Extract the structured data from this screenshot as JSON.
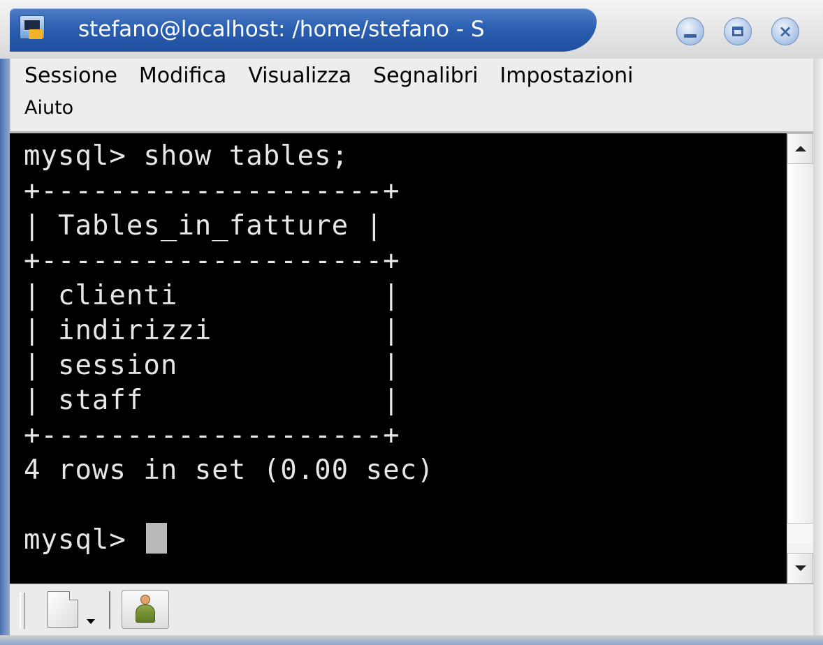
{
  "window": {
    "title": "stefano@localhost: /home/stefano - S"
  },
  "menu": {
    "items": [
      "Sessione",
      "Modifica",
      "Visualizza",
      "Segnalibri",
      "Impostazioni",
      "Aiuto"
    ]
  },
  "terminal": {
    "lines": [
      "mysql> show tables;",
      "+--------------------+",
      "| Tables_in_fatture |",
      "+--------------------+",
      "| clienti            |",
      "| indirizzi          |",
      "| session            |",
      "| staff              |",
      "+--------------------+",
      "4 rows in set (0.00 sec)",
      "",
      "mysql> "
    ]
  },
  "icons": {
    "app": "terminal-app-icon",
    "minimize": "minimize-icon",
    "maximize": "maximize-icon",
    "close": "close-icon",
    "new_session": "new-document-icon",
    "session": "user-icon"
  },
  "colors": {
    "titlebar": "#2b5fb1",
    "terminal_bg": "#000000",
    "terminal_fg": "#e6e6e6",
    "cursor": "#b9b9b9"
  }
}
